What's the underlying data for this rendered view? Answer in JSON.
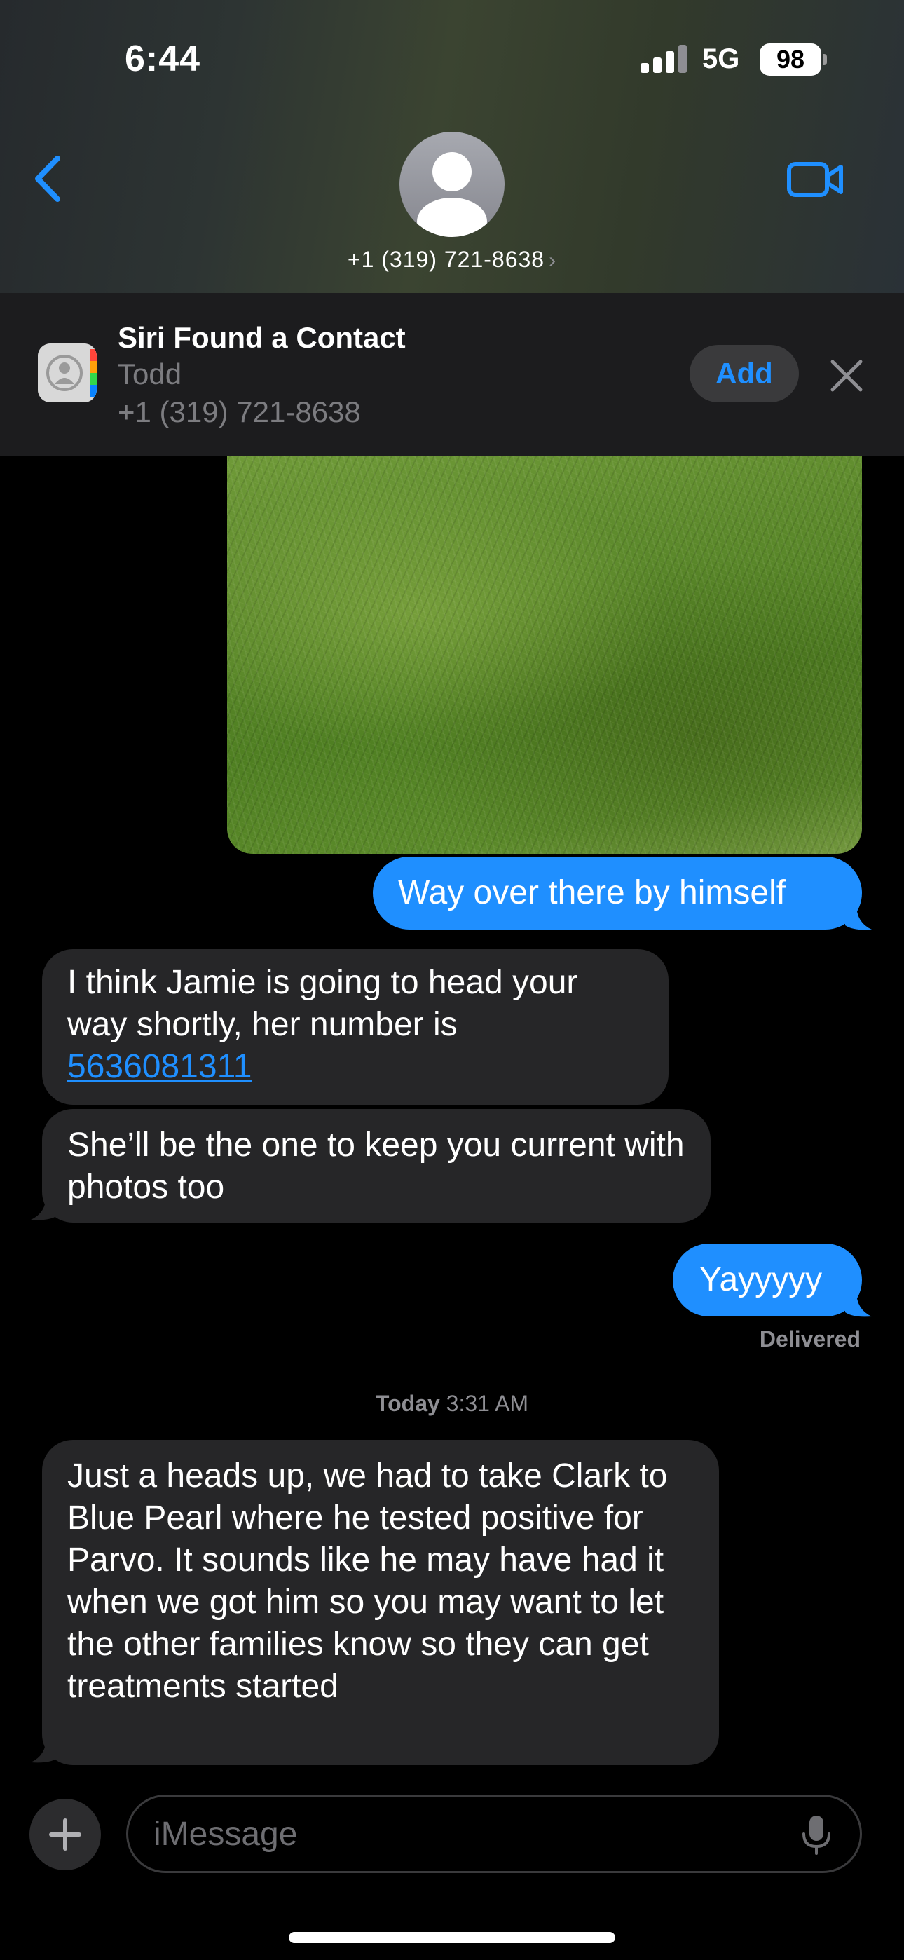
{
  "status_bar": {
    "time": "6:44",
    "network": "5G",
    "battery": "98"
  },
  "header": {
    "contact_name": "+1 (319) 721-8638",
    "chevron": "›",
    "back_icon": "chevron-left-icon",
    "video_icon": "video-camera-icon",
    "accent_color": "#1f8fff"
  },
  "siri_banner": {
    "title": "Siri Found a Contact",
    "name": "Todd",
    "number": "+1 (319) 721-8638",
    "add_label": "Add"
  },
  "messages": {
    "sent_1": "Way over there by himself",
    "recv_1_text": "I think Jamie is going to head your way shortly, her number is",
    "recv_1_link": "5636081311",
    "recv_2": "She’ll be the one to keep you current with photos too",
    "sent_2": "Yayyyyy",
    "delivered": "Delivered",
    "timestamp_day": "Today",
    "timestamp_time": "3:31 AM",
    "recv_3": "Just a heads up, we had to take Clark to Blue Pearl where he tested positive for Parvo. It sounds like he may have had it when we got him so you may want to let the other families know so they can get treatments started"
  },
  "compose": {
    "placeholder": "iMessage"
  }
}
